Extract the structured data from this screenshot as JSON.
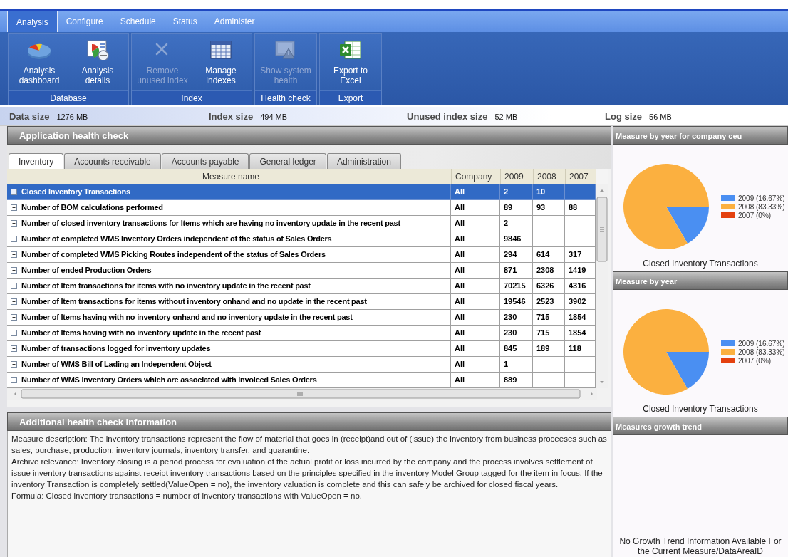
{
  "menu_tabs": [
    {
      "label": "Analysis",
      "selected": true
    },
    {
      "label": "Configure",
      "selected": false
    },
    {
      "label": "Schedule",
      "selected": false
    },
    {
      "label": "Status",
      "selected": false
    },
    {
      "label": "Administer",
      "selected": false
    }
  ],
  "ribbon": {
    "groups": [
      {
        "label": "Database",
        "buttons": [
          {
            "label": "Analysis dashboard",
            "kind": "pie",
            "disabled": false
          },
          {
            "label": "Analysis details",
            "kind": "report",
            "disabled": false
          }
        ]
      },
      {
        "label": "Index",
        "buttons": [
          {
            "label": "Remove unused index",
            "kind": "remove",
            "disabled": true
          },
          {
            "label": "Manage indexes",
            "kind": "table",
            "disabled": false
          }
        ]
      },
      {
        "label": "Health check",
        "buttons": [
          {
            "label": "Show system health",
            "kind": "monitor",
            "disabled": true
          }
        ]
      },
      {
        "label": "Export",
        "buttons": [
          {
            "label": "Export to Excel",
            "kind": "spreadsheet",
            "disabled": false
          }
        ]
      }
    ]
  },
  "stats": [
    {
      "label": "Data size",
      "value": "1276 MB"
    },
    {
      "label": "Index size",
      "value": "494 MB"
    },
    {
      "label": "Unused index size",
      "value": "52 MB"
    },
    {
      "label": "Log size",
      "value": "56 MB"
    }
  ],
  "health_check": {
    "title": "Application health check",
    "tabs": [
      {
        "label": "Inventory",
        "selected": true
      },
      {
        "label": "Accounts receivable",
        "selected": false
      },
      {
        "label": "Accounts payable",
        "selected": false
      },
      {
        "label": "General ledger",
        "selected": false
      },
      {
        "label": "Administration",
        "selected": false
      }
    ],
    "table": {
      "columns": [
        "Measure name",
        "Company",
        "2009",
        "2008",
        "2007"
      ],
      "rows": [
        {
          "name": "Closed Inventory Transactions",
          "company": "All",
          "values": [
            "2",
            "10"
          ],
          "selected": true
        },
        {
          "name": "Number of BOM calculations performed",
          "company": "All",
          "values": [
            "89",
            "93",
            "88"
          ],
          "selected": false
        },
        {
          "name": "Number of closed inventory transactions for Items which are having no inventory update in the recent past",
          "company": "All",
          "values": [
            "2"
          ],
          "selected": false
        },
        {
          "name": "Number of completed WMS Inventory Orders independent of the status of Sales Orders",
          "company": "All",
          "values": [
            "9846"
          ],
          "selected": false
        },
        {
          "name": "Number of completed WMS Picking Routes independent of the status of Sales Orders",
          "company": "All",
          "values": [
            "294",
            "614",
            "317"
          ],
          "selected": false
        },
        {
          "name": "Number of ended  Production Orders",
          "company": "All",
          "values": [
            "871",
            "2308",
            "1419"
          ],
          "selected": false
        },
        {
          "name": "Number of Item transactions for items with no inventory update  in the recent past",
          "company": "All",
          "values": [
            "70215",
            "6326",
            "4316"
          ],
          "selected": false
        },
        {
          "name": "Number of Item transactions for items without inventory onhand and no update in the recent past",
          "company": "All",
          "values": [
            "19546",
            "2523",
            "3902"
          ],
          "selected": false
        },
        {
          "name": "Number of Items having with no inventory onhand and no inventory update in the recent past",
          "company": "All",
          "values": [
            "230",
            "715",
            "1854"
          ],
          "selected": false
        },
        {
          "name": "Number of Items having with no inventory update in the recent past",
          "company": "All",
          "values": [
            "230",
            "715",
            "1854"
          ],
          "selected": false
        },
        {
          "name": "Number of transactions logged for inventory updates",
          "company": "All",
          "values": [
            "845",
            "189",
            "118"
          ],
          "selected": false
        },
        {
          "name": "Number of WMS Bill of Lading an Independent Object",
          "company": "All",
          "values": [
            "1"
          ],
          "selected": false
        },
        {
          "name": "Number of WMS Inventory  Orders which are associated with invoiced Sales Orders",
          "company": "All",
          "values": [
            "889"
          ],
          "selected": false
        }
      ]
    }
  },
  "additional_info": {
    "title": "Additional health check information",
    "paragraphs": [
      "Measure description: The inventory transactions represent  the flow of material that goes in (receipt)and out of (issue) the inventory from business proceeses such as sales, purchase, production, inventory journals, inventory transfer, and quarantine.",
      "Archive relevance: Inventory closing is a period process for evaluation of the actual profit or loss incurred by the company and the process involves settlement of issue inventory transactions against receipt inventory transactions based on the principles specified in the inventory Model Group tagged for the item in focus. If the inventory Transaction is completely settled(ValueOpen = no), the  inventory valuation  is complete and this can safely be archived for closed fiscal years.",
      "Formula: Closed inventory transactions = number of inventory transactions with ValueOpen = no."
    ]
  },
  "chart_panels": [
    {
      "title": "Measure by year for company ceu",
      "slices": [
        {
          "color": "#4a8ff2"
        },
        {
          "color": "#fbb040"
        },
        {
          "color": "#e4410f"
        }
      ],
      "chart_data": {
        "type": "pie",
        "title": "Closed Inventory Transactions",
        "categories": [
          "2009 (16.67%)",
          "2008 (83.33%)",
          "2007 (0%)"
        ],
        "values": [
          16.67,
          83.33,
          0
        ]
      }
    },
    {
      "title": "Measure by year",
      "slices": [
        {
          "color": "#4a8ff2"
        },
        {
          "color": "#fbb040"
        },
        {
          "color": "#e4410f"
        }
      ],
      "chart_data": {
        "type": "pie",
        "title": "Closed Inventory Transactions",
        "categories": [
          "2009 (16.67%)",
          "2008 (83.33%)",
          "2007 (0%)"
        ],
        "values": [
          16.67,
          83.33,
          0
        ]
      }
    }
  ],
  "growth_trend": {
    "title": "Measures growth trend",
    "message": "No Growth Trend Information Available For the Current Measure/DataAreaID"
  }
}
